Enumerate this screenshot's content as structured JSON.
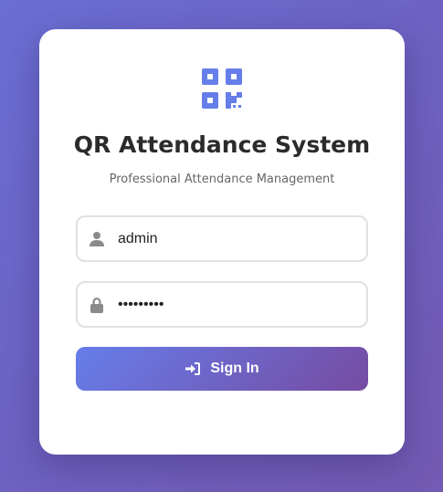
{
  "app": {
    "title": "QR Attendance System",
    "subtitle": "Professional Attendance Management",
    "logo_icon": "qrcode-icon"
  },
  "form": {
    "username": {
      "value": "admin",
      "icon": "user-icon"
    },
    "password": {
      "value": "adminpass",
      "icon": "lock-icon"
    },
    "submit": {
      "label": "Sign In",
      "icon": "sign-in-icon"
    }
  },
  "colors": {
    "background_start": "#6a6fd4",
    "background_end": "#735ab3",
    "accent": "#667eea",
    "button_start": "#667eea",
    "button_end": "#764ba2",
    "title": "#2b2b2b",
    "icon_gray": "#8a8a8a"
  }
}
